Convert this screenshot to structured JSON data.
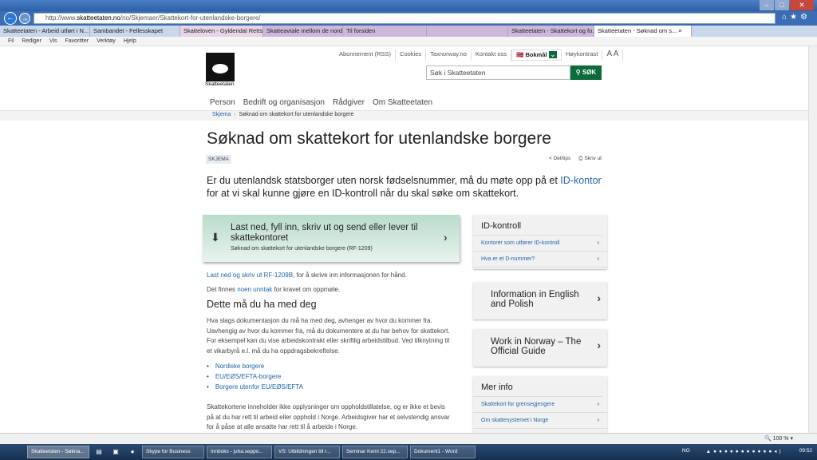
{
  "browser": {
    "url_prefix": "http://www.",
    "url_domain": "skatteetaten.no",
    "url_path": "/no/Skjemaer/Skattekort-for-utenlandske-borgere/",
    "tabs": [
      "Skatteetaten - Arbeid utført i N...",
      "Sambandet - Fellesskapet",
      "Skatteloven - Gyldendal Rettsd...",
      "Skatteavtale mellom de nordis...",
      "Til forsiden",
      "",
      "Skatteetaten - Skattekort og fo...",
      "Skatteetaten - Søknad om s... ×"
    ],
    "menu": [
      "Fil",
      "Rediger",
      "Vis",
      "Favoritter",
      "Verktøy",
      "Hjelp"
    ],
    "zoom": "100 %"
  },
  "header": {
    "logo_text": "Skatteetaten",
    "top_links": [
      "Abonnement (RSS)",
      "Cookies",
      "Taxnorway.no",
      "Kontakt oss"
    ],
    "language": "Bokmål",
    "high_contrast": "Høykontrast",
    "font_size": "A A",
    "search_placeholder": "Søk i Skatteetaten",
    "search_button": "SØK",
    "nav": [
      "Person",
      "Bedrift og organisasjon",
      "Rådgiver",
      "Om Skatteetaten"
    ],
    "breadcrumb": {
      "parent": "Skjema",
      "current": "Søknad om skattekort for utenlandske borgere"
    }
  },
  "main": {
    "title": "Søknad om skattekort for utenlandske borgere",
    "badge": "SKJEMA",
    "share": "Del/tips",
    "print": "Skriv ut",
    "intro_before": "Er du utenlandsk statsborger uten norsk fødselsnummer, må du møte opp på et ",
    "intro_link": "ID-kontor",
    "intro_after": " for at vi skal kunne gjøre en ID-kontroll når du skal søke om skattekort.",
    "download": {
      "title": "Last ned, fyll inn, skriv ut og send eller lever til skattekontoret",
      "subtitle": "Søknad om skattekort for utenlandske borgere (RF-1209)"
    },
    "p1_link": "Last ned og skriv ut RF-1209B",
    "p1_rest": ", for å skrive inn informasjonen for hånd.",
    "p2_before": "Det finnes ",
    "p2_link": "noen unntak",
    "p2_after": " for kravet om oppmøte.",
    "h2": "Dette må du ha med deg",
    "p3": "Hva slags dokumentasjon du må ha med deg, avhenger av hvor du kommer fra. Uavhengig av hvor du kommer fra, må du dokumentere at du har behov for skattekort. For eksempel kan du vise arbeidskontrakt eller skriftlig arbeidstilbud. Ved tilknytning til et vikarbyrå e.l. må du ha oppdragsbekreftelse.",
    "list": [
      "Nordiske borgere",
      "EU/EØS/EFTA-borgere",
      "Borgere utenfor EU/EØS/EFTA"
    ],
    "p4": "Skattekortene inneholder ikke opplysninger om oppholdstillatelse, og er ikke et bevis på at du har rett til arbeid eller opphold i Norge. Arbeidsgiver har et selvstendig ansvar for å påse at alle ansatte har rett til å arbeide i Norge."
  },
  "sidebar": {
    "id_title": "ID-kontroll",
    "id_links": [
      "Kontorer som utfører ID-kontroll",
      "Hva er et D-nummer?"
    ],
    "english": "Information in English and Polish",
    "work": "Work in Norway – The Official Guide",
    "more_title": "Mer info",
    "more_links": [
      "Skattekort for grensegjengere",
      "Om skattesystemet i Norge"
    ]
  },
  "taskbar": {
    "items": [
      "Skatteetaten - Søkna...",
      "Skype for Business",
      "Innboks - juha.seppo...",
      "VS: Utbildningen till r...",
      "Seminar Kemi 22.sep...",
      "Dokument1 - Word"
    ],
    "lang": "NO",
    "clock": "09:52"
  },
  "colors": {
    "link": "#1f65a8",
    "brand_green": "#0b6b3a",
    "download_bg": "#b9dccb"
  }
}
